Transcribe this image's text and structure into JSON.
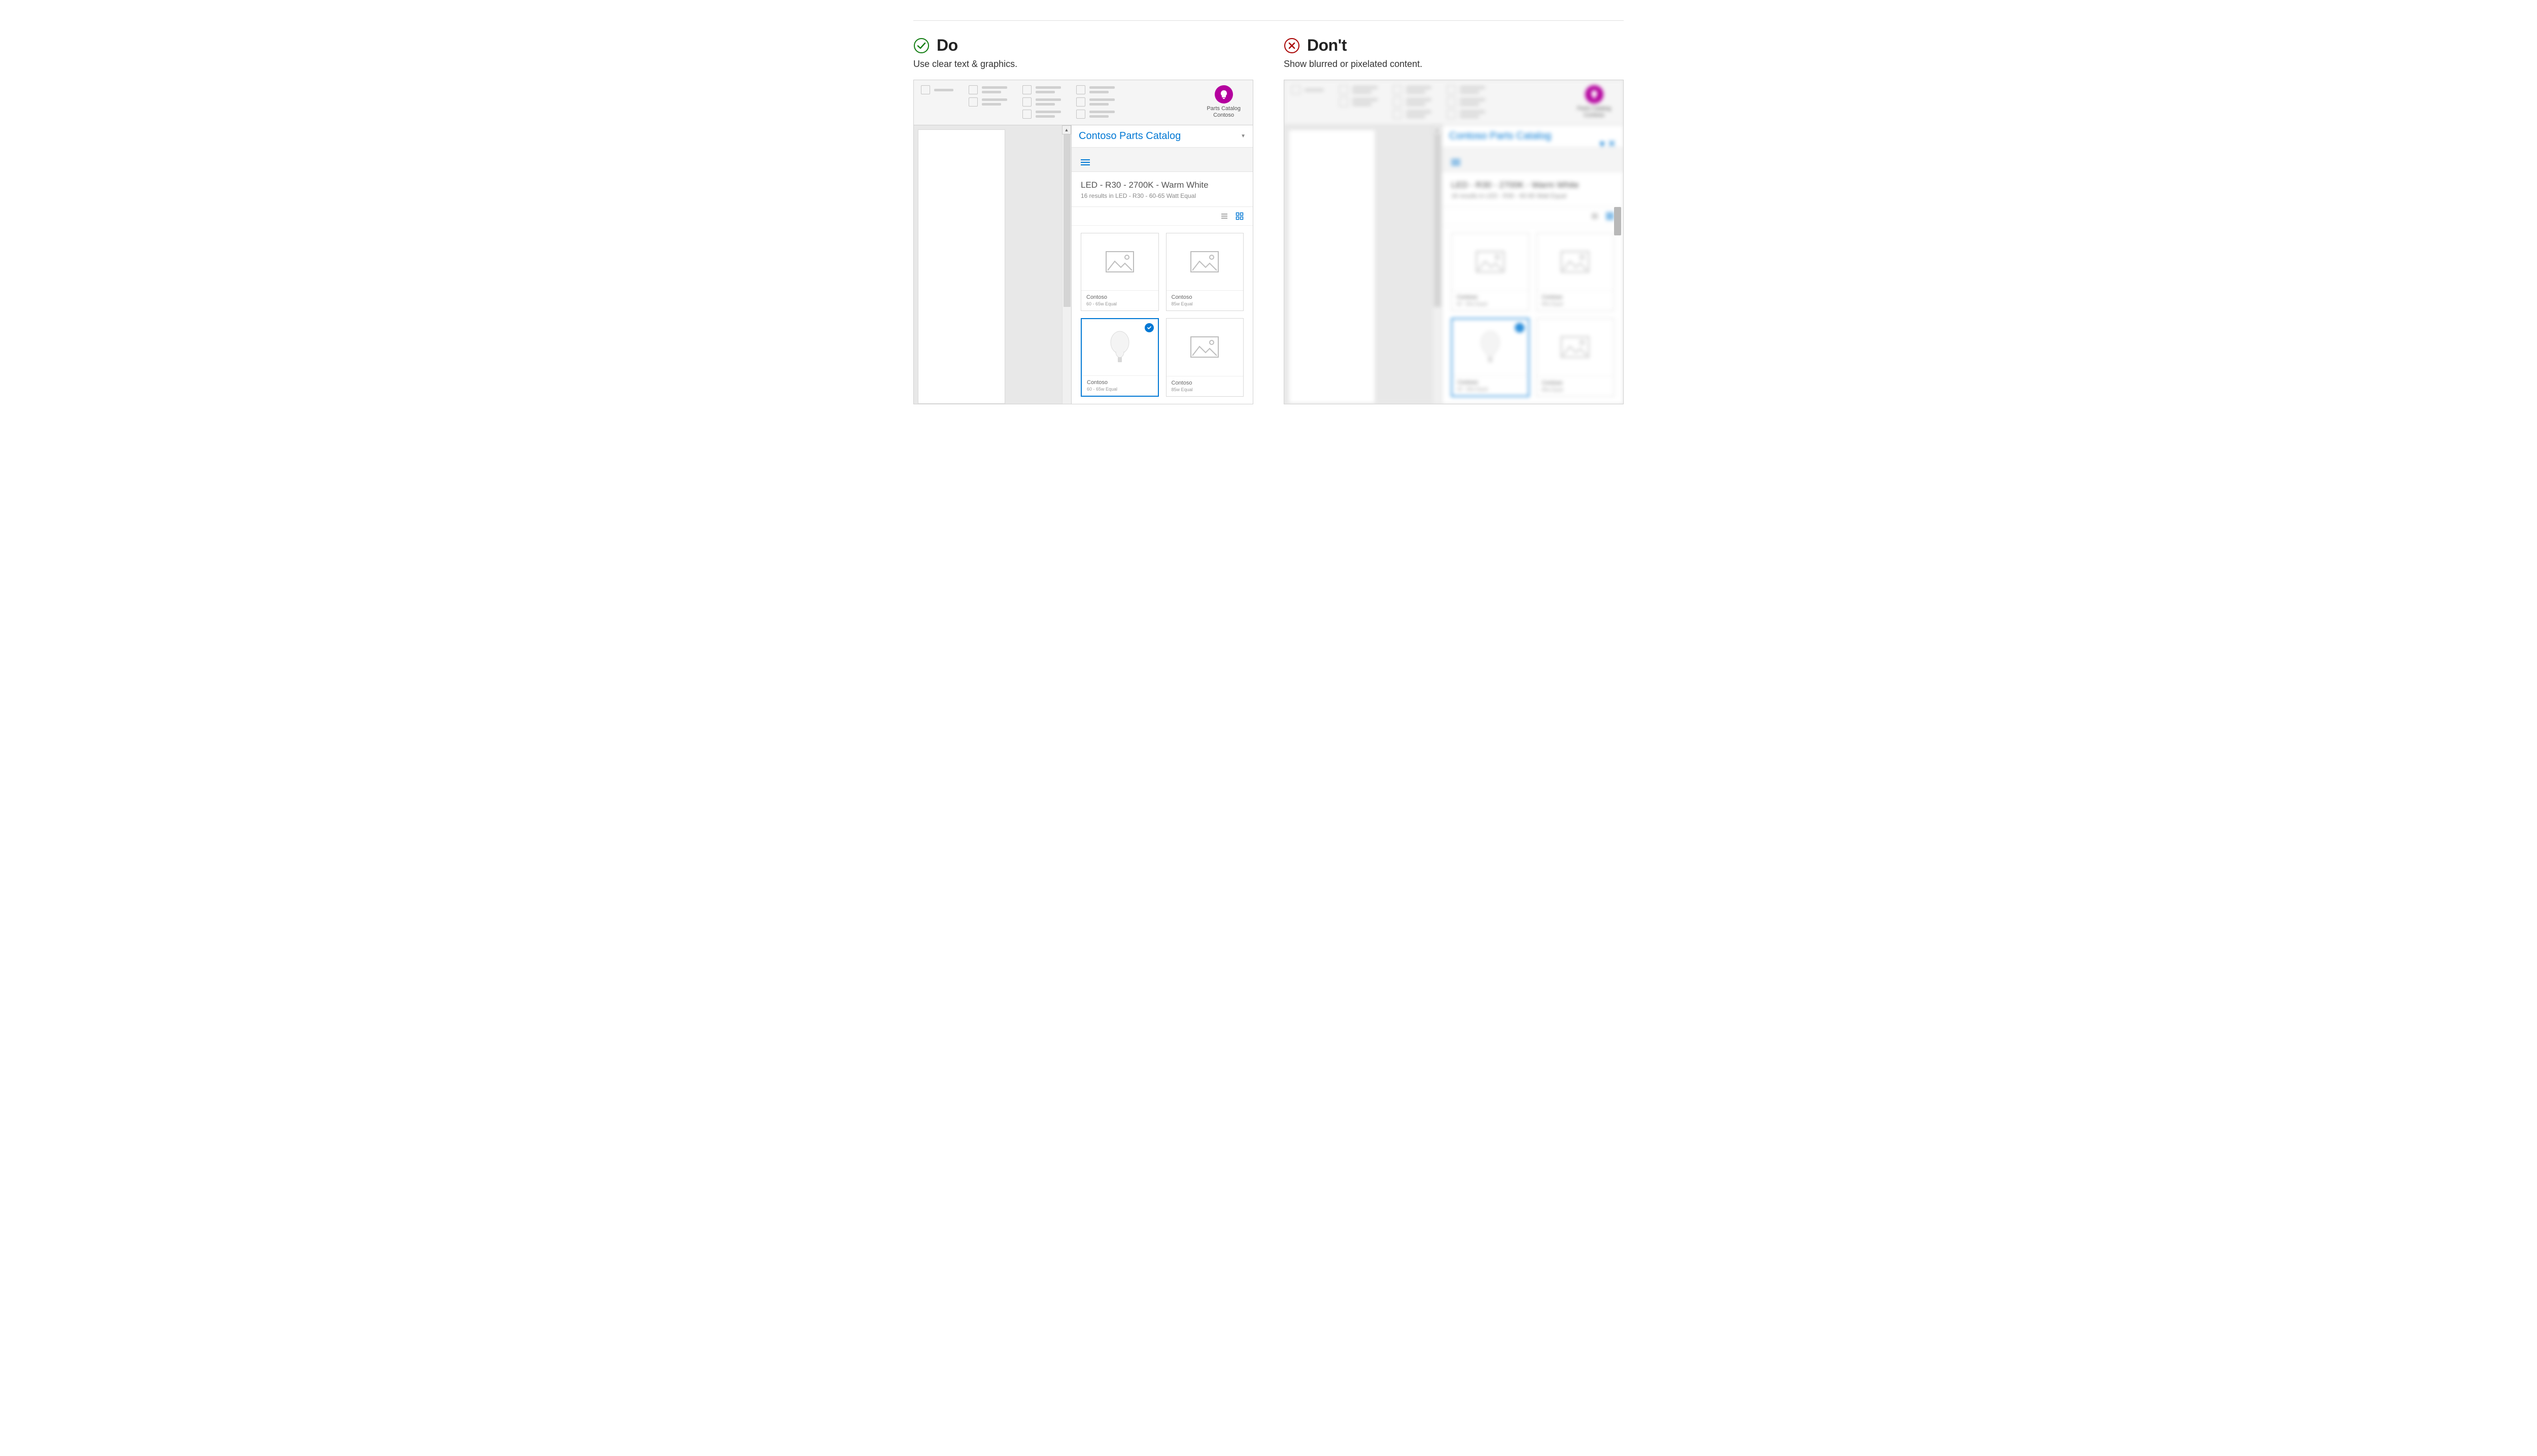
{
  "do": {
    "heading": "Do",
    "sub": "Use clear text & graphics."
  },
  "dont": {
    "heading": "Don't",
    "sub": "Show blurred or pixelated content."
  },
  "ribbon": {
    "addin_title": "Parts Catalog",
    "addin_company": "Contoso"
  },
  "taskpane": {
    "title": "Contoso Parts Catalog",
    "heading": "LED - R30 - 2700K - Warm White",
    "sub": "16 results in LED - R30 - 60-65 Watt Equal"
  },
  "cards": [
    {
      "brand": "Contoso",
      "spec": "60 - 65w Equal",
      "selected": false,
      "image": "placeholder"
    },
    {
      "brand": "Contoso",
      "spec": "85w Equal",
      "selected": false,
      "image": "placeholder"
    },
    {
      "brand": "Contoso",
      "spec": "60 - 65w Equal",
      "selected": true,
      "image": "bulb"
    },
    {
      "brand": "Contoso",
      "spec": "85w Equal",
      "selected": false,
      "image": "placeholder"
    }
  ]
}
